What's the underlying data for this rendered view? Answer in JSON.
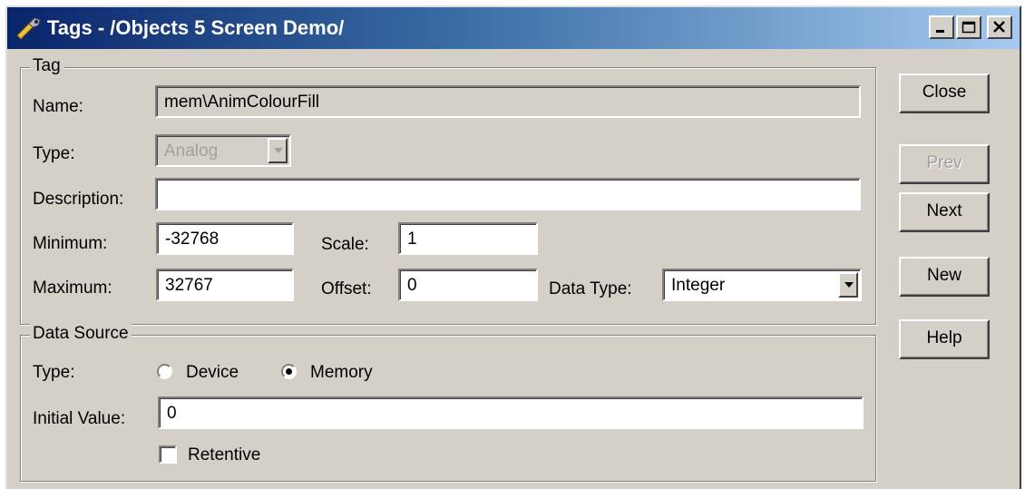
{
  "window": {
    "title": "Tags - /Objects 5 Screen Demo/"
  },
  "tag_group": {
    "label": "Tag",
    "name_label": "Name:",
    "name_value": "mem\\AnimColourFill",
    "type_label": "Type:",
    "type_value": "Analog",
    "description_label": "Description:",
    "description_value": "",
    "minimum_label": "Minimum:",
    "minimum_value": "-32768",
    "maximum_label": "Maximum:",
    "maximum_value": "32767",
    "scale_label": "Scale:",
    "scale_value": "1",
    "offset_label": "Offset:",
    "offset_value": "0",
    "data_type_label": "Data Type:",
    "data_type_value": "Integer"
  },
  "data_source": {
    "label": "Data Source",
    "type_label": "Type:",
    "device_label": "Device",
    "memory_label": "Memory",
    "selected": "Memory",
    "initial_value_label": "Initial Value:",
    "initial_value": "0",
    "retentive_label": "Retentive",
    "retentive_checked": false
  },
  "buttons": {
    "close": "Close",
    "prev": "Prev",
    "next": "Next",
    "new": "New",
    "help": "Help"
  },
  "icons": {
    "title": "tag-wrench-icon",
    "minimize": "minimize-icon",
    "maximize": "maximize-icon",
    "close": "close-icon",
    "dropdown": "chevron-down-icon"
  },
  "colors": {
    "titlebar_start": "#0a246a",
    "titlebar_end": "#a6caf0",
    "face": "#d4d0c8"
  }
}
